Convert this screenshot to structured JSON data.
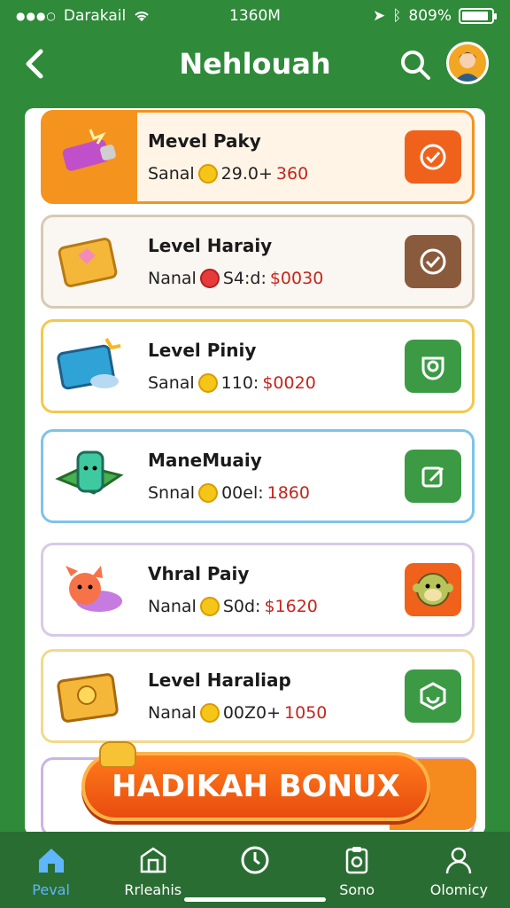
{
  "status_bar": {
    "carrier": "Darakail",
    "time": "1360M",
    "battery": "809%",
    "battery_level": 0.9
  },
  "header": {
    "title": "Nehlouah",
    "back_icon": "back-arrow-icon",
    "search_icon": "search-icon"
  },
  "items": [
    {
      "title": "Mevel Paky",
      "label": "Sanal",
      "code": "29.0+",
      "price": "360",
      "accent": "#f5931f",
      "action_color": "#f0621c"
    },
    {
      "title": "Level Haraiy",
      "label": "Nanal",
      "code": "S4:d:",
      "price": "$0030",
      "accent": "#d9c9b4",
      "action_color": "#8a5a3c"
    },
    {
      "title": "Level Piniy",
      "label": "Sanal",
      "code": "110:",
      "price": "$0020",
      "accent": "#f2c94c",
      "action_color": "#3c9a45"
    },
    {
      "title": "ManeMuaiy",
      "label": "Snnal",
      "code": "00el:",
      "price": "1860",
      "accent": "#7ec3ea",
      "action_color": "#3c9a45"
    },
    {
      "title": "Vhral Paiy",
      "label": "Nanal",
      "code": "S0d:",
      "price": "$1620",
      "accent": "#d9c9e6",
      "action_color": "#f0621c"
    },
    {
      "title": "Level Haraliap",
      "label": "Nanal",
      "code": "00Z0+",
      "price": "1050",
      "accent": "#f2d98c",
      "action_color": "#3c9a45"
    }
  ],
  "bonus": {
    "label": "HADIKAH BONUX"
  },
  "nav": [
    {
      "label": "Peval",
      "icon": "home-icon",
      "active": true
    },
    {
      "label": "Rrleahis",
      "icon": "shop-icon",
      "active": false
    },
    {
      "label": "",
      "icon": "timer-icon",
      "active": false
    },
    {
      "label": "Sono",
      "icon": "clipboard-icon",
      "active": false
    },
    {
      "label": "Olomicy",
      "icon": "profile-icon",
      "active": false
    }
  ]
}
